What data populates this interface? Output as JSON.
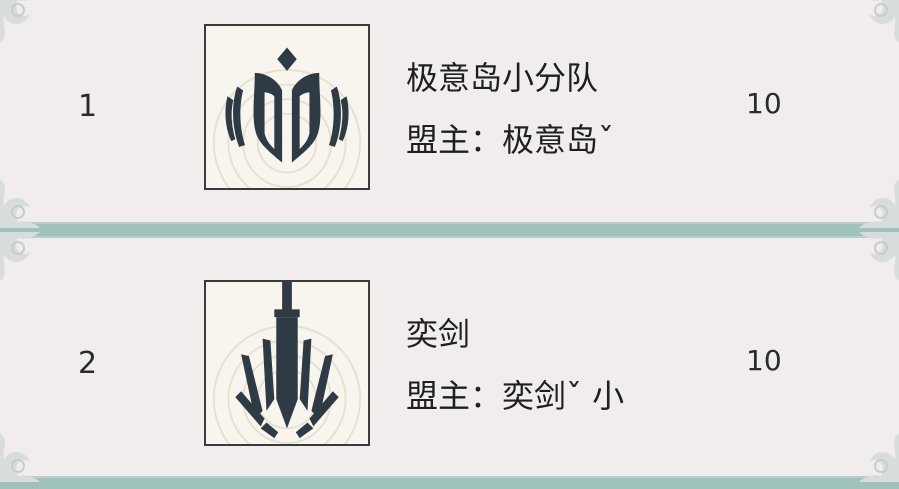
{
  "alliances": [
    {
      "rank": "1",
      "name": "极意岛小分队",
      "leader_line": "盟主：极意岛ˇ",
      "score": "10",
      "emblem_icon": "crown-shield-emblem"
    },
    {
      "rank": "2",
      "name": "奕剑",
      "leader_line": "盟主：奕剑ˇ 小",
      "score": "10",
      "emblem_icon": "sword-emblem"
    }
  ],
  "colors": {
    "row_background": "#f1eded",
    "divider": "#9fc2bd",
    "emblem_ink": "#2f3b44",
    "emblem_background": "#f7f5ee"
  }
}
